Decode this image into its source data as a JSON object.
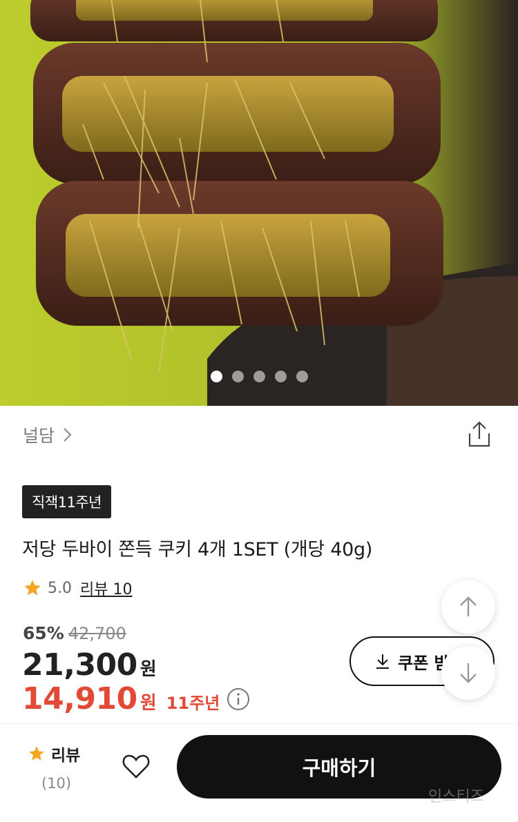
{
  "carousel": {
    "total": 5,
    "active_index": 0
  },
  "brand": {
    "name": "널담"
  },
  "product": {
    "badge": "직잭11주년",
    "title": "저당 두바이 쫀득 쿠키 4개 1SET (개당 40g)"
  },
  "rating": {
    "score": "5.0",
    "review_label": "리뷰 10"
  },
  "pricing": {
    "discount_rate": "65%",
    "original_price": "42,700",
    "price": "21,300",
    "currency": "원",
    "final_price": "14,910",
    "final_currency": "원",
    "promo_label": "11주년"
  },
  "coupon": {
    "label": "쿠폰 받"
  },
  "bottom_bar": {
    "review_label": "리뷰",
    "review_count": "(10)",
    "buy_label": "구매하기"
  },
  "watermark": "인스티즈",
  "colors": {
    "accent_red": "#e24a36",
    "star": "#f5a623",
    "dark": "#111111"
  }
}
